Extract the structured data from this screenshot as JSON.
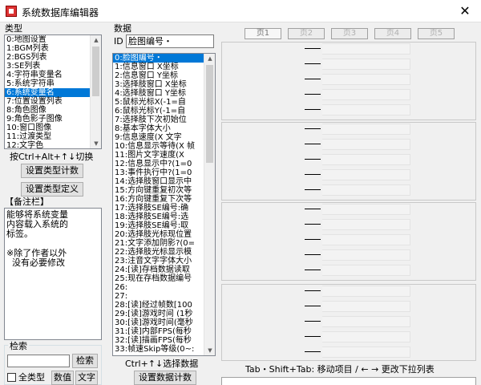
{
  "window": {
    "title": "系统数据库编辑器",
    "close_label": "✕"
  },
  "types": {
    "header": "类型",
    "items": [
      "0:地图设置",
      "1:BGM列表",
      "2:BGS列表",
      "3:SE列表",
      "4:字符串变量名",
      "5:系统字符串",
      "6:系统变量名",
      "7:位置设置列表",
      "8:角色图像",
      "9:角色影子图像",
      "10:窗口图像",
      "11:过渡类型",
      "12:文字色"
    ],
    "selected_index": 6,
    "switch_hint": "按Ctrl+Alt+↑↓切换",
    "set_count_button": "设置类型计数",
    "define_button": "设置类型定义"
  },
  "memo": {
    "header": "【备注栏】",
    "text": "能够将系统变量\n内容载入系统的\n标签。\n\n※除了作者以外\n  没有必要修改"
  },
  "search": {
    "header": "检索",
    "value": "",
    "search_button": "检索",
    "all_types_label": "全类型",
    "all_types_checked": false,
    "numeric_button": "数值",
    "text_button": "文字"
  },
  "data": {
    "header": "数据",
    "id_label": "ID",
    "id_value": "脸图编号・",
    "items": [
      "0:脸图编号・",
      "1:信息窗口 X坐标",
      "2:信息窗口 Y坐标",
      "3:选择肢窗口 X坐标",
      "4:选择肢窗口 Y坐标",
      "5:鼠标光标X(-1=自",
      "6:鼠标光标Y(-1=自",
      "7:选择肢下次初始位",
      "8:基本字体大小",
      "9:信息速度(X 文字",
      "10:信息显示等待(X 帧",
      "11:图片文字速度(X",
      "12:信息显示中?(1=0",
      "13:事件执行中?(1=0",
      "14:选择肢窗口显示中",
      "15:方向键重复初次等",
      "16:方向键重复下次等",
      "17:选择肢SE编号:确",
      "18:选择肢SE编号:选",
      "19:选择肢SE编号:取",
      "20:选择肢光标现位置",
      "21:文字添加阴影?(0=",
      "22:选择肢光标显示模",
      "23:注音文字字体大小",
      "24:[读]存档数据读取",
      "25:现在存档数据编号",
      "26:",
      "27:",
      "28:[读]经过帧数[100",
      "29:[读]游戏时间 (1秒",
      "30:[读]游戏时间(毫秒",
      "31:[读]内部FPS(每秒",
      "32:[读]描画FPS(每秒",
      "33:帧速Skip等级(0~:"
    ],
    "selected_index": 0,
    "select_hint": "Ctrl+↑↓选择数据",
    "set_count_button": "设置数据计数"
  },
  "pages": {
    "tabs": [
      "页1",
      "页2",
      "页3",
      "页4",
      "页5"
    ],
    "active_index": 0,
    "status": "Tab・Shift+Tab: 移动项目 / ← → 更改下拉列表"
  }
}
